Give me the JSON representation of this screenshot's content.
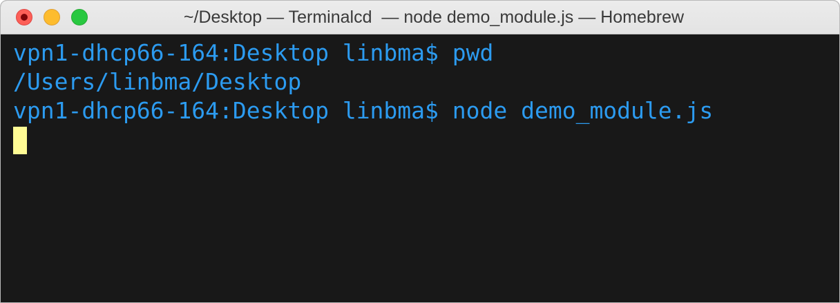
{
  "window": {
    "title": "~/Desktop — Terminalcd  — node demo_module.js — Homebrew"
  },
  "terminal": {
    "lines": [
      "vpn1-dhcp66-164:Desktop linbma$ pwd",
      "/Users/linbma/Desktop",
      "vpn1-dhcp66-164:Desktop linbma$ node demo_module.js"
    ],
    "text_color": "#2c9bf0",
    "background_color": "#181818",
    "cursor_color": "#fffb94"
  },
  "icons": {
    "close": "close-icon",
    "minimize": "minimize-icon",
    "zoom": "zoom-icon",
    "folder": "folder-icon"
  }
}
